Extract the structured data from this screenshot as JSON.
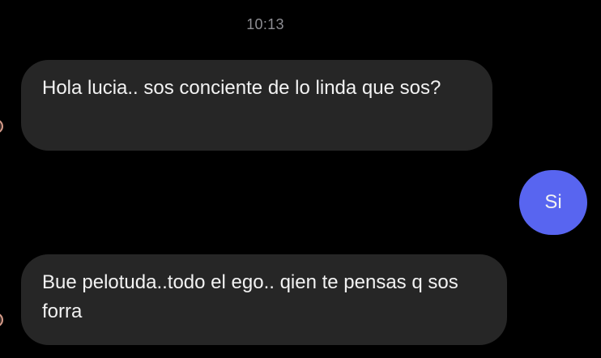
{
  "chat": {
    "timestamp": "10:13",
    "messages": [
      {
        "direction": "incoming",
        "text": "Hola lucia.. sos conciente de lo linda que sos?"
      },
      {
        "direction": "outgoing",
        "text": "Si"
      },
      {
        "direction": "incoming",
        "text": "Bue pelotuda..todo el ego.. qien te pensas q sos forra"
      }
    ]
  },
  "colors": {
    "background": "#000000",
    "incoming_bubble": "#262626",
    "outgoing_bubble": "#5865f0",
    "timestamp_text": "#8e8e93",
    "message_text": "#f2f2f2"
  }
}
